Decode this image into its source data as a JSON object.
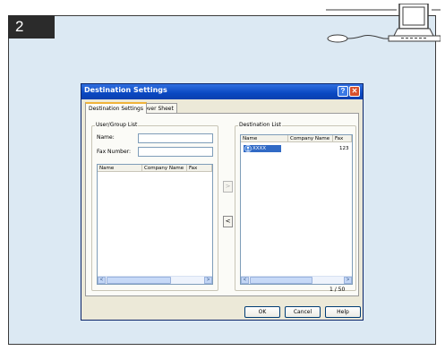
{
  "step": {
    "number": "2"
  },
  "dialog": {
    "title": "Destination Settings",
    "help_glyph": "?",
    "close_glyph": "✕",
    "tabs": [
      {
        "label": "Destination Settings"
      },
      {
        "label": "Cover Sheet"
      }
    ],
    "user_group": {
      "legend": "User/Group List",
      "name_label": "Name:",
      "name_value": "",
      "fax_label": "Fax Number:",
      "fax_value": "",
      "columns": [
        "Name",
        "Company Name",
        "Fax"
      ]
    },
    "move_buttons": {
      "add": ">",
      "remove": "<"
    },
    "destination": {
      "legend": "Destination List",
      "columns": [
        "Name",
        "Company Name",
        "Fax"
      ],
      "rows": [
        {
          "name": "XXXX",
          "fax": "123"
        }
      ],
      "page_count": "1 / 50"
    },
    "scroll": {
      "left": "<",
      "right": ">"
    },
    "buttons": {
      "ok": "OK",
      "cancel": "Cancel",
      "help": "Help"
    }
  },
  "colors": {
    "panel_bg": "#dce9f3",
    "title_bar": "#0a48c2",
    "selection": "#316ac5",
    "close_button": "#d7502c"
  }
}
